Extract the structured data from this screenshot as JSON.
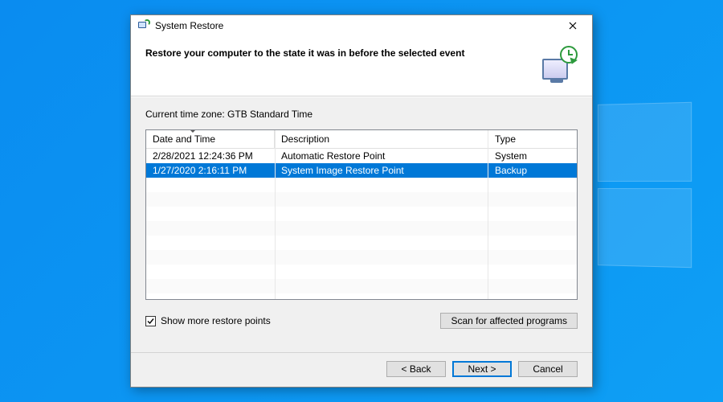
{
  "window": {
    "title": "System Restore"
  },
  "header": {
    "heading": "Restore your computer to the state it was in before the selected event"
  },
  "body": {
    "timezone_label": "Current time zone: GTB Standard Time",
    "columns": {
      "date_time": "Date and Time",
      "description": "Description",
      "type": "Type"
    },
    "rows": [
      {
        "date_time": "2/28/2021 12:24:36 PM",
        "description": "Automatic Restore Point",
        "type": "System",
        "selected": false
      },
      {
        "date_time": "1/27/2020 2:16:11 PM",
        "description": "System Image Restore Point",
        "type": "Backup",
        "selected": true
      }
    ],
    "show_more_checked": true,
    "show_more_label": "Show more restore points",
    "scan_button": "Scan for affected programs"
  },
  "footer": {
    "back": "< Back",
    "next": "Next >",
    "cancel": "Cancel"
  }
}
